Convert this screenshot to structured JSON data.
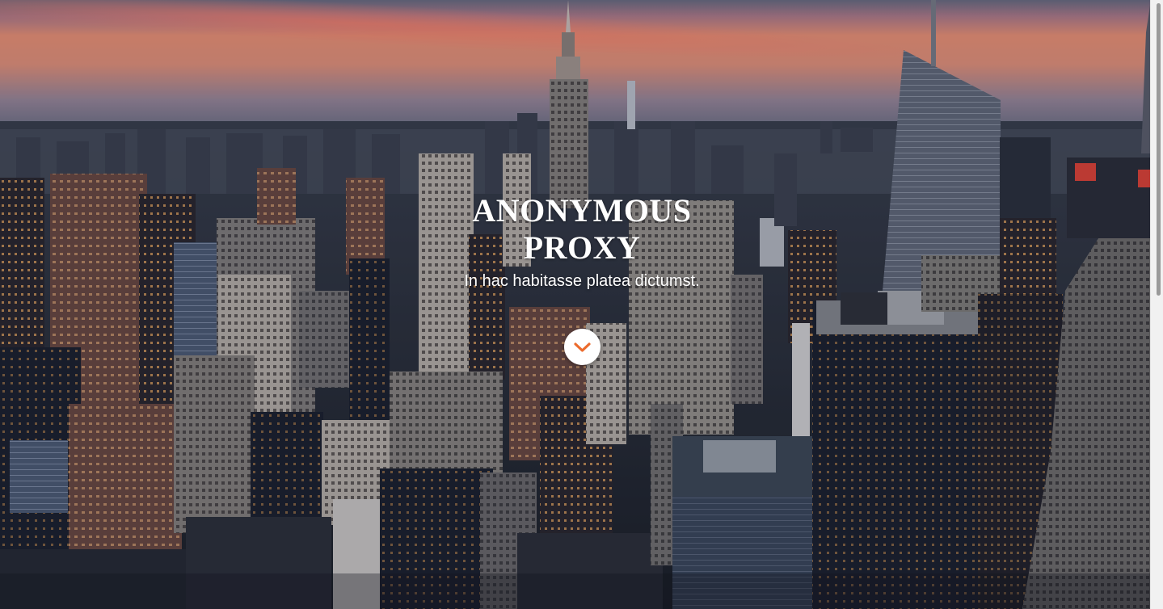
{
  "hero": {
    "title_line1": "ANONYMOUS",
    "title_line2": "PROXY",
    "subtitle": "In hac habitasse platea dictumst."
  },
  "scroll_button": {
    "icon": "chevron-down-icon",
    "icon_color": "#ec6b2d",
    "background": "#ffffff"
  },
  "background_image": {
    "description_icon": "city-skyline-photo"
  },
  "colors": {
    "accent": "#ec6b2d",
    "text": "#ffffff"
  }
}
